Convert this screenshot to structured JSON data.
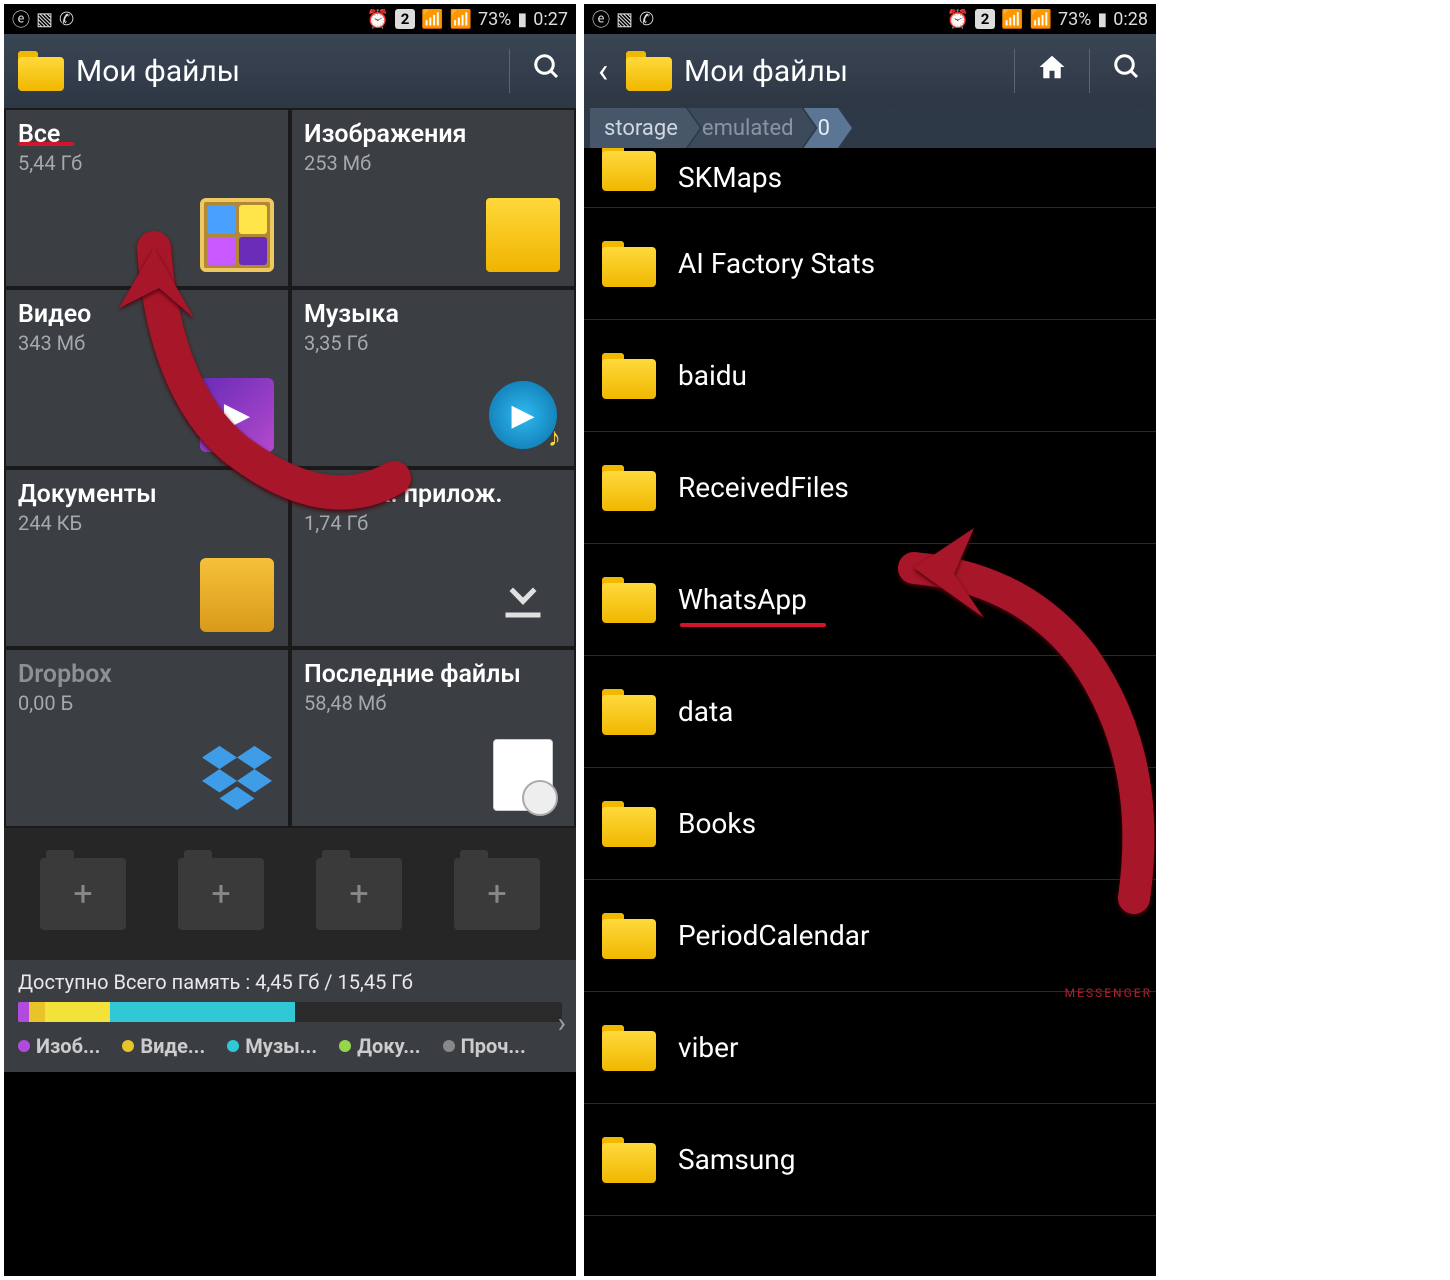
{
  "left": {
    "status": {
      "battery": "73%",
      "time": "0:27",
      "sim": "2"
    },
    "title": "Мои файлы",
    "tiles": [
      {
        "title": "Все",
        "sub": "5,44 Гб",
        "icon": "gallery-tile-icon"
      },
      {
        "title": "Изображения",
        "sub": "253 Мб",
        "icon": "photo-tile-icon"
      },
      {
        "title": "Видео",
        "sub": "343 Мб",
        "icon": "video-tile-icon"
      },
      {
        "title": "Музыка",
        "sub": "3,35 Гб",
        "icon": "music-tile-icon"
      },
      {
        "title": "Документы",
        "sub": "244 КБ",
        "icon": "docs-tile-icon"
      },
      {
        "title": "Загруж. прилож.",
        "sub": "1,74 Гб",
        "icon": "download-tile-icon"
      },
      {
        "title": "Dropbox",
        "sub": "0,00 Б",
        "icon": "dropbox-tile-icon"
      },
      {
        "title": "Последние файлы",
        "sub": "58,48 Мб",
        "icon": "recent-tile-icon"
      }
    ],
    "storage": {
      "text": "Доступно Всего память : 4,45 Гб / 15,45 Гб",
      "legend": [
        "Изоб...",
        "Виде...",
        "Музы...",
        "Доку...",
        "Проч..."
      ]
    }
  },
  "right": {
    "status": {
      "battery": "73%",
      "time": "0:28",
      "sim": "2"
    },
    "title": "Мои файлы",
    "breadcrumb": [
      "storage",
      "emulated",
      "0"
    ],
    "folders": [
      "SKMaps",
      "AI Factory Stats",
      "baidu",
      "ReceivedFiles",
      "WhatsApp",
      "data",
      "Books",
      "PeriodCalendar",
      "viber",
      "Samsung"
    ],
    "watermark": "MESSENGER"
  }
}
